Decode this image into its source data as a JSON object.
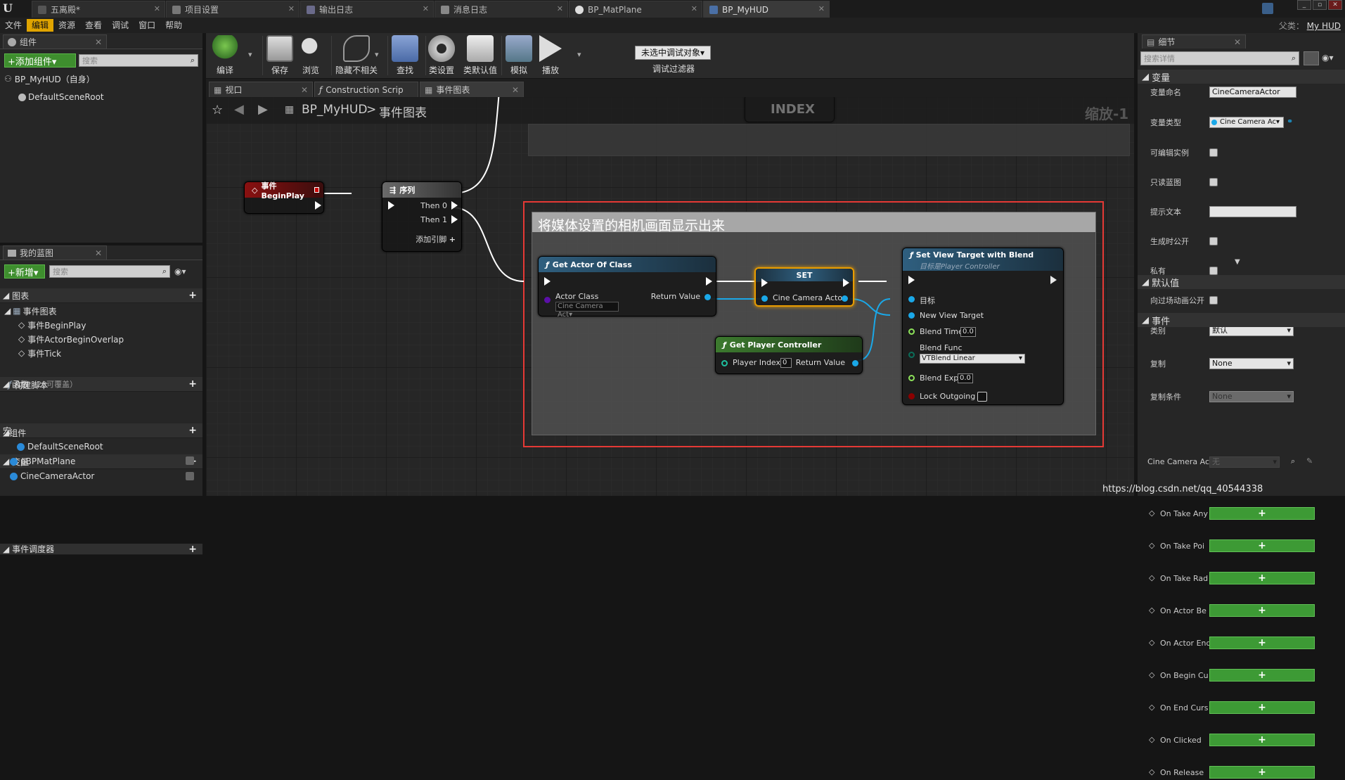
{
  "doc_tabs": [
    {
      "label": "五离殿*",
      "icon": "level-icon",
      "active": false
    },
    {
      "label": "项目设置",
      "icon": "settings-icon",
      "active": false
    },
    {
      "label": "输出日志",
      "icon": "log-icon",
      "active": false
    },
    {
      "label": "消息日志",
      "icon": "message-icon",
      "active": false
    },
    {
      "label": "BP_MatPlane",
      "icon": "sphere-icon",
      "active": false
    },
    {
      "label": "BP_MyHUD",
      "icon": "blueprint-icon",
      "active": true
    }
  ],
  "menu": [
    "文件",
    "编辑",
    "资源",
    "查看",
    "调试",
    "窗口",
    "帮助"
  ],
  "menu_active_index": 1,
  "parent_class": {
    "label": "父类：",
    "value": "My HUD"
  },
  "components": {
    "tab": "组件",
    "add_button": "+添加组件▾",
    "search_placeholder": "搜索",
    "root": "BP_MyHUD（自身）",
    "child": "DefaultSceneRoot"
  },
  "my_blueprint": {
    "tab": "我的蓝图",
    "new_button": "+新增▾",
    "search_placeholder": "搜索",
    "sections": {
      "graphs": "图表",
      "event_graph": "事件图表",
      "events": [
        "事件BeginPlay",
        "事件ActorBeginOverlap",
        "事件Tick"
      ],
      "functions": "函数",
      "functions_note": "（20可覆盖）",
      "construction": "构建脚本",
      "macros": "宏",
      "variables": "变量",
      "components": "组件",
      "component_items": [
        "DefaultSceneRoot",
        "pBPMatPlane",
        "CineCameraActor"
      ],
      "dispatchers": "事件调度器"
    }
  },
  "toolbar": [
    {
      "label": "编译",
      "icon": "compile-icon"
    },
    {
      "label": "保存",
      "icon": "save-icon"
    },
    {
      "label": "浏览",
      "icon": "browse-icon"
    },
    {
      "label": "隐藏不相关",
      "icon": "hide-unrelated-icon"
    },
    {
      "label": "查找",
      "icon": "find-icon"
    },
    {
      "label": "类设置",
      "icon": "class-settings-icon"
    },
    {
      "label": "类默认值",
      "icon": "class-defaults-icon"
    },
    {
      "label": "模拟",
      "icon": "simulate-icon"
    },
    {
      "label": "播放",
      "icon": "play-icon"
    }
  ],
  "debug_filter": {
    "dropdown": "未选中调试对象▾",
    "label": "调试过滤器"
  },
  "graph_tabs": [
    {
      "label": "视口",
      "icon": "viewport-icon"
    },
    {
      "label": "Construction Scrip",
      "icon": "function-icon"
    },
    {
      "label": "事件图表",
      "icon": "graph-icon"
    }
  ],
  "breadcrumb": {
    "blueprint": "BP_MyHUD",
    "separator": ">",
    "graph": "事件图表"
  },
  "zoom": "缩放-1",
  "comment": "将媒体设置的相机画面显示出来",
  "nodes": {
    "begin_play": "事件BeginPlay",
    "sequence": {
      "title": "序列",
      "then0": "Then 0",
      "then1": "Then 1",
      "add_pin": "添加引脚"
    },
    "get_actor_of_class": {
      "title": "Get Actor Of Class",
      "actor_class": "Actor Class",
      "class_value": "Cine Camera Act▾",
      "return": "Return Value"
    },
    "set": {
      "title": "SET",
      "pin": "Cine Camera Actor"
    },
    "set_view_target": {
      "title": "Set View Target with Blend",
      "subtitle": "目标是Player Controller",
      "target": "目标",
      "new_view_target": "New View Target",
      "blend_time": "Blend Time",
      "blend_time_val": "0.0",
      "blend_func": "Blend Func",
      "blend_func_val": "VTBlend Linear",
      "blend_exp": "Blend Exp",
      "blend_exp_val": "0.0",
      "lock_outgoing": "Lock Outgoing"
    },
    "get_player_controller": {
      "title": "Get Player Controller",
      "player_index": "Player Index",
      "player_index_val": "0",
      "return": "Return Value"
    },
    "index_node": "INDEX"
  },
  "details": {
    "tab": "细节",
    "search_placeholder": "搜索详情",
    "variable_section": "变量",
    "rows": [
      {
        "label": "变量命名",
        "type": "text",
        "value": "CineCameraActor"
      },
      {
        "label": "变量类型",
        "type": "type",
        "value": "Cine Camera Ac▾"
      },
      {
        "label": "可编辑实例",
        "type": "check"
      },
      {
        "label": "只读蓝图",
        "type": "check"
      },
      {
        "label": "提示文本",
        "type": "text",
        "value": ""
      },
      {
        "label": "生成时公开",
        "type": "check"
      },
      {
        "label": "私有",
        "type": "check"
      },
      {
        "label": "向过场动画公开",
        "type": "check"
      },
      {
        "label": "类别",
        "type": "dropdown",
        "value": "默认"
      },
      {
        "label": "复制",
        "type": "dropdown",
        "value": "None"
      },
      {
        "label": "复制条件",
        "type": "dropdown",
        "value": "None"
      }
    ],
    "default_section": "默认值",
    "default_row": {
      "label": "Cine Camera Act",
      "value": "无"
    },
    "events_section": "事件",
    "events": [
      "On Take Any",
      "On Take Poi",
      "On Take Rad",
      "On Actor Be",
      "On Actor End",
      "On Begin Cu",
      "On End Curs",
      "On Clicked",
      "On Release"
    ]
  },
  "watermark": "https://blog.csdn.net/qq_40544338",
  "colors": {
    "accent": "#e0a400",
    "comment_border": "#e53935",
    "add_green": "#3d9a35",
    "exec": "#ffffff",
    "object_pin": "#1aa8e8",
    "float_pin": "#8de25a",
    "byte_pin": "#0b6e5a",
    "bool_pin": "#8b0000",
    "class_pin": "#5b0fa8"
  }
}
